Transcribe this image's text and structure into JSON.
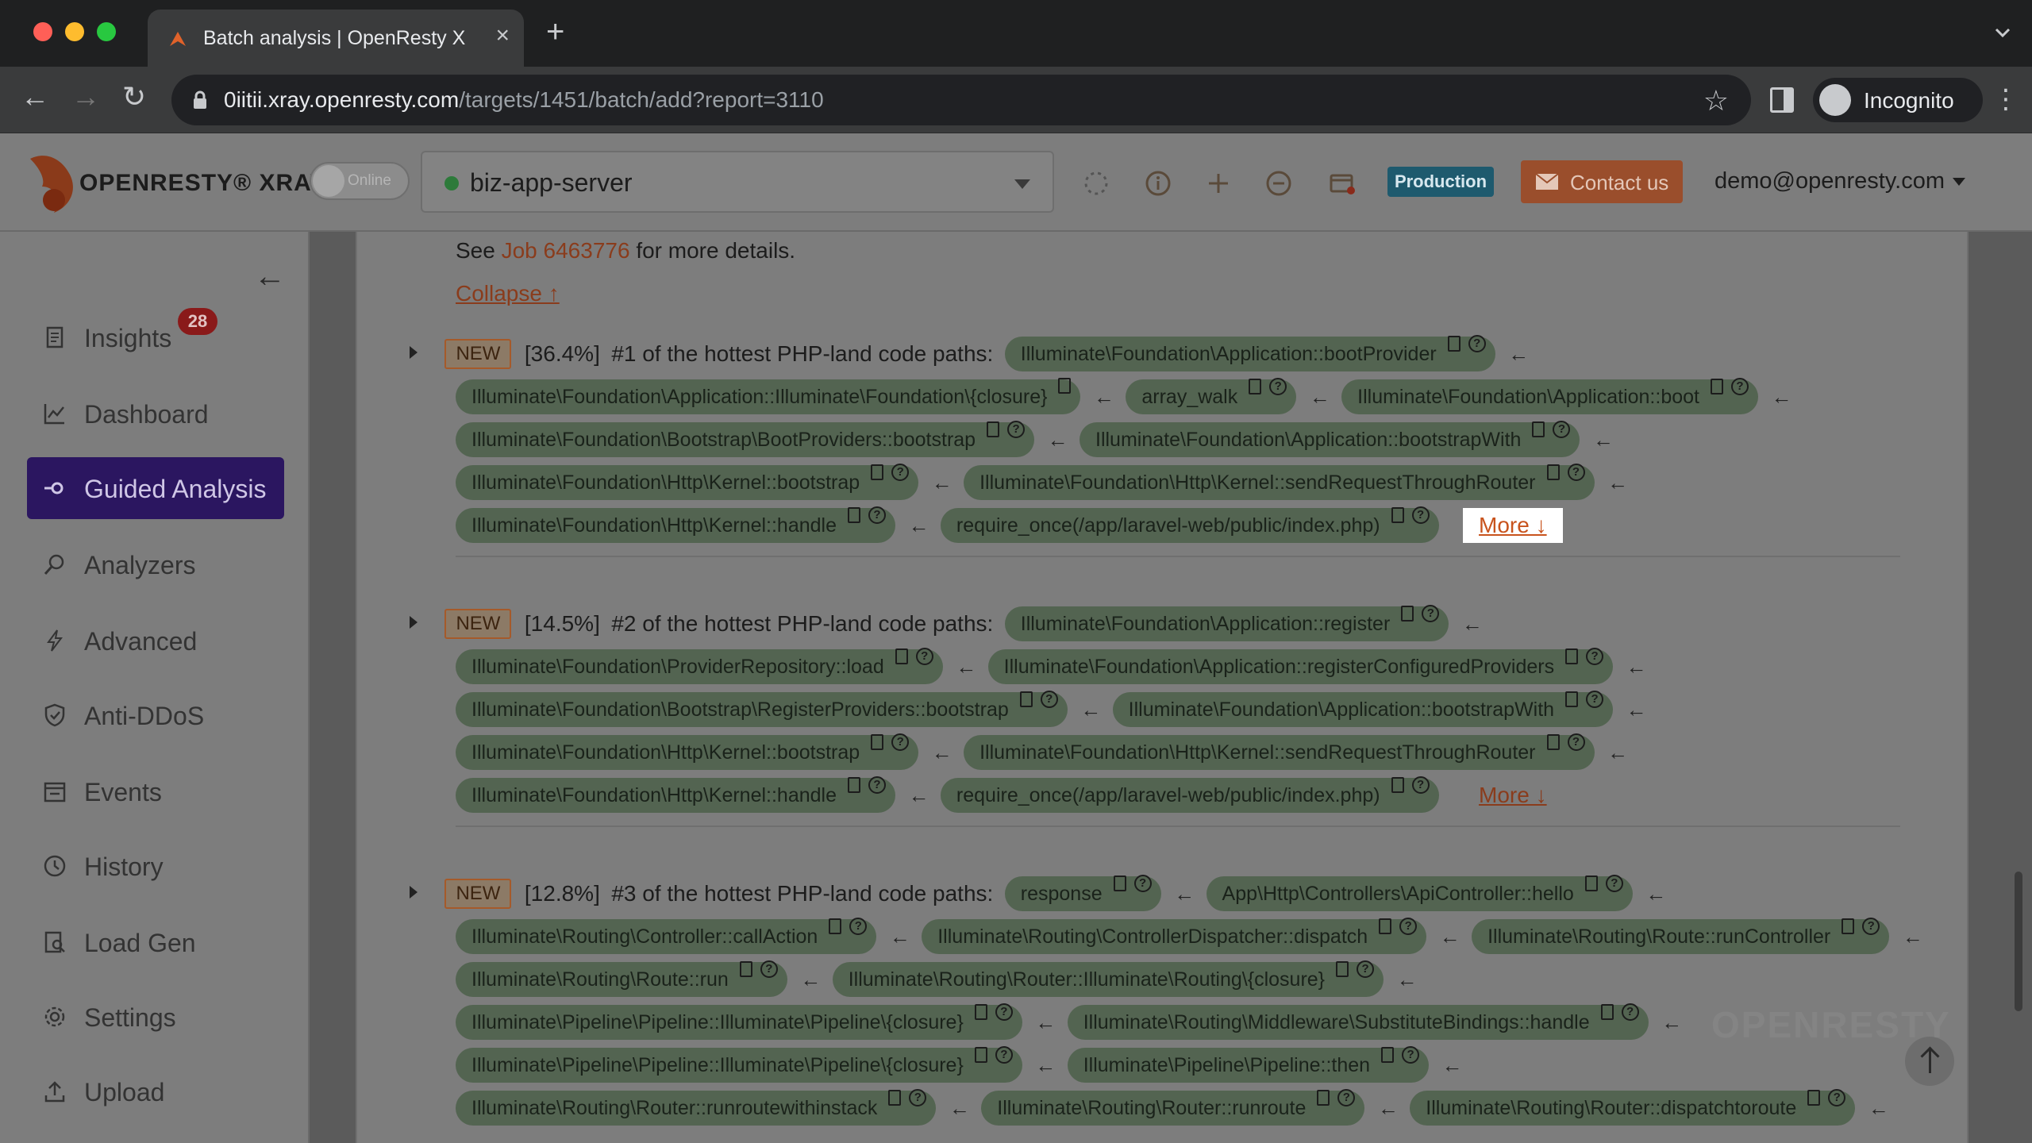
{
  "browser": {
    "tab_title": "Batch analysis | OpenResty XRay",
    "url_host": "0iitii.xray.openresty.com",
    "url_path": "/targets/1451/batch/add?report=3110",
    "profile_label": "Incognito"
  },
  "header": {
    "logo_text": "OPENRESTY® XRAY",
    "online_label": "Online",
    "target_name": "biz-app-server",
    "env_badge": "Production",
    "contact_label": "Contact us",
    "user_email": "demo@openresty.com"
  },
  "sidebar": {
    "items": [
      {
        "label": "Insights",
        "badge": "28"
      },
      {
        "label": "Dashboard"
      },
      {
        "label": "Guided Analysis"
      },
      {
        "label": "Analyzers"
      },
      {
        "label": "Advanced"
      },
      {
        "label": "Anti-DDoS"
      },
      {
        "label": "Events"
      },
      {
        "label": "History"
      },
      {
        "label": "Load Gen"
      },
      {
        "label": "Settings"
      },
      {
        "label": "Upload"
      }
    ]
  },
  "main": {
    "see_prefix": "See",
    "job_link": "Job 6463776",
    "see_suffix": "for more details.",
    "collapse_label": "Collapse ↑",
    "more_label": "More ↓",
    "new_label": "NEW",
    "paths": [
      {
        "percent": "[36.4%]",
        "title": "#1 of the hottest PHP-land code paths:",
        "frames": [
          "Illuminate\\Foundation\\Application::bootProvider",
          "Illuminate\\Foundation\\Application::Illuminate\\Foundation\\{closure}",
          "array_walk",
          "Illuminate\\Foundation\\Application::boot",
          "Illuminate\\Foundation\\Bootstrap\\BootProviders::bootstrap",
          "Illuminate\\Foundation\\Application::bootstrapWith",
          "Illuminate\\Foundation\\Http\\Kernel::bootstrap",
          "Illuminate\\Foundation\\Http\\Kernel::sendRequestThroughRouter",
          "Illuminate\\Foundation\\Http\\Kernel::handle",
          "require_once(/app/laravel-web/public/index.php)"
        ]
      },
      {
        "percent": "[14.5%]",
        "title": "#2 of the hottest PHP-land code paths:",
        "frames": [
          "Illuminate\\Foundation\\Application::register",
          "Illuminate\\Foundation\\ProviderRepository::load",
          "Illuminate\\Foundation\\Application::registerConfiguredProviders",
          "Illuminate\\Foundation\\Bootstrap\\RegisterProviders::bootstrap",
          "Illuminate\\Foundation\\Application::bootstrapWith",
          "Illuminate\\Foundation\\Http\\Kernel::bootstrap",
          "Illuminate\\Foundation\\Http\\Kernel::sendRequestThroughRouter",
          "Illuminate\\Foundation\\Http\\Kernel::handle",
          "require_once(/app/laravel-web/public/index.php)"
        ]
      },
      {
        "percent": "[12.8%]",
        "title": "#3 of the hottest PHP-land code paths:",
        "frames": [
          "response",
          "App\\Http\\Controllers\\ApiController::hello",
          "Illuminate\\Routing\\Controller::callAction",
          "Illuminate\\Routing\\ControllerDispatcher::dispatch",
          "Illuminate\\Routing\\Route::runController",
          "Illuminate\\Routing\\Route::run",
          "Illuminate\\Routing\\Router::Illuminate\\Routing\\{closure}",
          "Illuminate\\Pipeline\\Pipeline::Illuminate\\Pipeline\\{closure}",
          "Illuminate\\Routing\\Middleware\\SubstituteBindings::handle",
          "Illuminate\\Pipeline\\Pipeline::Illuminate\\Pipeline\\{closure}",
          "Illuminate\\Pipeline\\Pipeline::then",
          "Illuminate\\Routing\\Router::runroutewithinstack",
          "Illuminate\\Routing\\Router::runroute",
          "Illuminate\\Routing\\Router::dispatchtoroute"
        ]
      }
    ]
  },
  "colors": {
    "accent": "#c8531d",
    "nav_active": "#2b1660",
    "frame_pill": "#536451",
    "online_dot": "#2d7a3a"
  }
}
